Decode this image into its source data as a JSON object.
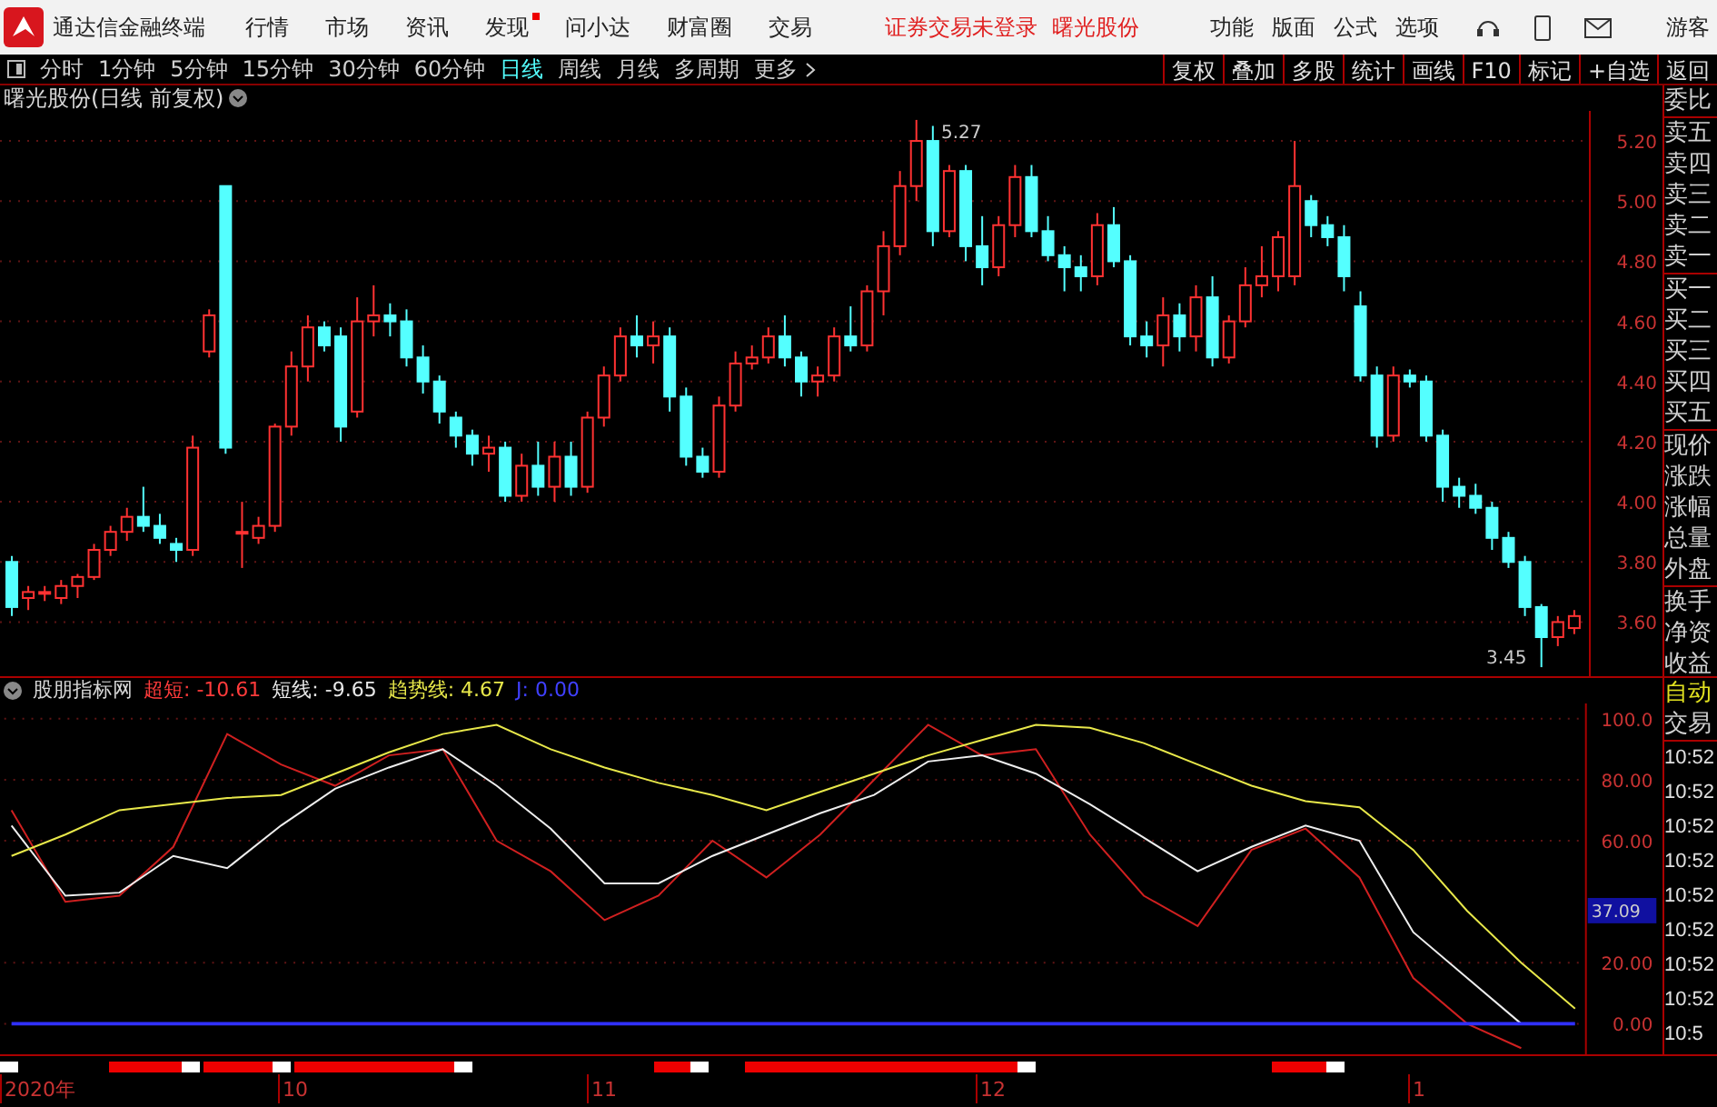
{
  "top_bar": {
    "app_title": "通达信金融终端",
    "menu": [
      {
        "label": "行情",
        "dot": false
      },
      {
        "label": "市场",
        "dot": false
      },
      {
        "label": "资讯",
        "dot": false
      },
      {
        "label": "发现",
        "dot": true
      },
      {
        "label": "问小达",
        "dot": false
      },
      {
        "label": "财富圈",
        "dot": false
      },
      {
        "label": "交易",
        "dot": false
      }
    ],
    "status": "证券交易未登录",
    "stock": "曙光股份",
    "tools": [
      "功能",
      "版面",
      "公式",
      "选项"
    ],
    "user": "游客"
  },
  "toolbar": {
    "periods": [
      {
        "label": "分时",
        "selected": false
      },
      {
        "label": "1分钟",
        "selected": false
      },
      {
        "label": "5分钟",
        "selected": false
      },
      {
        "label": "15分钟",
        "selected": false
      },
      {
        "label": "30分钟",
        "selected": false
      },
      {
        "label": "60分钟",
        "selected": false
      },
      {
        "label": "日线",
        "selected": true
      },
      {
        "label": "周线",
        "selected": false
      },
      {
        "label": "月线",
        "selected": false
      },
      {
        "label": "多周期",
        "selected": false
      },
      {
        "label": "更多",
        "selected": false
      }
    ],
    "actions": [
      "复权",
      "叠加",
      "多股",
      "统计",
      "画线",
      "F10",
      "标记",
      "+自选",
      "返回"
    ]
  },
  "price_chart": {
    "title": "曙光股份(日线 前复权)",
    "high_label": "5.27",
    "low_label": "3.45",
    "chart_data": {
      "type": "candlestick",
      "grid": true,
      "ylim": [
        3.42,
        5.3
      ],
      "yticks": [
        {
          "value": 5.2,
          "label": "5.20"
        },
        {
          "value": 5.0,
          "label": "5.00"
        },
        {
          "value": 4.8,
          "label": "4.80"
        },
        {
          "value": 4.6,
          "label": "4.60"
        },
        {
          "value": 4.4,
          "label": "4.40"
        },
        {
          "value": 4.2,
          "label": "4.20"
        },
        {
          "value": 4.0,
          "label": "4.00"
        },
        {
          "value": 3.8,
          "label": "3.80"
        },
        {
          "value": 3.6,
          "label": "3.60"
        }
      ],
      "ohlc": [
        [
          3.8,
          3.82,
          3.62,
          3.65
        ],
        [
          3.68,
          3.72,
          3.64,
          3.7
        ],
        [
          3.7,
          3.72,
          3.67,
          3.7
        ],
        [
          3.68,
          3.74,
          3.66,
          3.72
        ],
        [
          3.72,
          3.76,
          3.68,
          3.75
        ],
        [
          3.75,
          3.86,
          3.74,
          3.84
        ],
        [
          3.84,
          3.92,
          3.82,
          3.9
        ],
        [
          3.9,
          3.98,
          3.87,
          3.95
        ],
        [
          3.95,
          4.05,
          3.9,
          3.92
        ],
        [
          3.92,
          3.96,
          3.86,
          3.88
        ],
        [
          3.86,
          3.88,
          3.8,
          3.84
        ],
        [
          3.84,
          4.22,
          3.82,
          4.18
        ],
        [
          4.5,
          4.64,
          4.48,
          4.62
        ],
        [
          5.05,
          5.05,
          4.16,
          4.18
        ],
        [
          3.9,
          4.0,
          3.78,
          3.9
        ],
        [
          3.88,
          3.95,
          3.86,
          3.92
        ],
        [
          3.92,
          4.26,
          3.9,
          4.25
        ],
        [
          4.25,
          4.5,
          4.22,
          4.45
        ],
        [
          4.45,
          4.62,
          4.4,
          4.58
        ],
        [
          4.58,
          4.6,
          4.5,
          4.52
        ],
        [
          4.55,
          4.58,
          4.2,
          4.25
        ],
        [
          4.3,
          4.68,
          4.28,
          4.6
        ],
        [
          4.6,
          4.72,
          4.55,
          4.62
        ],
        [
          4.62,
          4.66,
          4.55,
          4.6
        ],
        [
          4.6,
          4.64,
          4.45,
          4.48
        ],
        [
          4.48,
          4.52,
          4.36,
          4.4
        ],
        [
          4.4,
          4.42,
          4.26,
          4.3
        ],
        [
          4.28,
          4.3,
          4.18,
          4.22
        ],
        [
          4.22,
          4.24,
          4.12,
          4.16
        ],
        [
          4.16,
          4.22,
          4.1,
          4.18
        ],
        [
          4.18,
          4.2,
          4.0,
          4.02
        ],
        [
          4.02,
          4.16,
          4.0,
          4.12
        ],
        [
          4.12,
          4.2,
          4.02,
          4.05
        ],
        [
          4.05,
          4.2,
          4.0,
          4.15
        ],
        [
          4.15,
          4.2,
          4.02,
          4.05
        ],
        [
          4.05,
          4.3,
          4.03,
          4.28
        ],
        [
          4.28,
          4.45,
          4.25,
          4.42
        ],
        [
          4.42,
          4.58,
          4.4,
          4.55
        ],
        [
          4.55,
          4.62,
          4.48,
          4.52
        ],
        [
          4.52,
          4.6,
          4.46,
          4.55
        ],
        [
          4.55,
          4.58,
          4.3,
          4.35
        ],
        [
          4.35,
          4.38,
          4.12,
          4.15
        ],
        [
          4.15,
          4.18,
          4.08,
          4.1
        ],
        [
          4.1,
          4.35,
          4.08,
          4.32
        ],
        [
          4.32,
          4.5,
          4.3,
          4.46
        ],
        [
          4.46,
          4.52,
          4.44,
          4.48
        ],
        [
          4.48,
          4.58,
          4.46,
          4.55
        ],
        [
          4.55,
          4.62,
          4.45,
          4.48
        ],
        [
          4.48,
          4.5,
          4.35,
          4.4
        ],
        [
          4.4,
          4.45,
          4.35,
          4.42
        ],
        [
          4.42,
          4.58,
          4.4,
          4.55
        ],
        [
          4.55,
          4.65,
          4.5,
          4.52
        ],
        [
          4.52,
          4.72,
          4.5,
          4.7
        ],
        [
          4.7,
          4.9,
          4.62,
          4.85
        ],
        [
          4.85,
          5.1,
          4.82,
          5.05
        ],
        [
          5.05,
          5.27,
          5.0,
          5.2
        ],
        [
          5.2,
          5.25,
          4.85,
          4.9
        ],
        [
          4.9,
          5.12,
          4.88,
          5.1
        ],
        [
          5.1,
          5.12,
          4.8,
          4.85
        ],
        [
          4.85,
          4.95,
          4.72,
          4.78
        ],
        [
          4.78,
          4.95,
          4.75,
          4.92
        ],
        [
          4.92,
          5.12,
          4.88,
          5.08
        ],
        [
          5.08,
          5.12,
          4.88,
          4.9
        ],
        [
          4.9,
          4.95,
          4.8,
          4.82
        ],
        [
          4.82,
          4.85,
          4.7,
          4.78
        ],
        [
          4.78,
          4.82,
          4.7,
          4.75
        ],
        [
          4.75,
          4.96,
          4.72,
          4.92
        ],
        [
          4.92,
          4.98,
          4.78,
          4.8
        ],
        [
          4.8,
          4.82,
          4.52,
          4.55
        ],
        [
          4.55,
          4.6,
          4.48,
          4.52
        ],
        [
          4.52,
          4.68,
          4.45,
          4.62
        ],
        [
          4.62,
          4.66,
          4.5,
          4.55
        ],
        [
          4.55,
          4.72,
          4.5,
          4.68
        ],
        [
          4.68,
          4.75,
          4.45,
          4.48
        ],
        [
          4.48,
          4.62,
          4.46,
          4.6
        ],
        [
          4.6,
          4.78,
          4.58,
          4.72
        ],
        [
          4.72,
          4.85,
          4.68,
          4.75
        ],
        [
          4.75,
          4.9,
          4.7,
          4.88
        ],
        [
          4.75,
          5.2,
          4.72,
          5.05
        ],
        [
          5.0,
          5.02,
          4.88,
          4.92
        ],
        [
          4.92,
          4.95,
          4.85,
          4.88
        ],
        [
          4.88,
          4.92,
          4.7,
          4.75
        ],
        [
          4.65,
          4.7,
          4.4,
          4.42
        ],
        [
          4.42,
          4.45,
          4.18,
          4.22
        ],
        [
          4.22,
          4.45,
          4.2,
          4.42
        ],
        [
          4.42,
          4.44,
          4.38,
          4.4
        ],
        [
          4.4,
          4.42,
          4.2,
          4.22
        ],
        [
          4.22,
          4.24,
          4.0,
          4.05
        ],
        [
          4.05,
          4.08,
          3.98,
          4.02
        ],
        [
          4.02,
          4.06,
          3.96,
          3.98
        ],
        [
          3.98,
          4.0,
          3.84,
          3.88
        ],
        [
          3.88,
          3.9,
          3.78,
          3.8
        ],
        [
          3.8,
          3.82,
          3.62,
          3.65
        ],
        [
          3.65,
          3.66,
          3.45,
          3.55
        ],
        [
          3.55,
          3.62,
          3.52,
          3.6
        ],
        [
          3.58,
          3.64,
          3.56,
          3.62
        ]
      ]
    }
  },
  "quote_panel": {
    "groups": [
      {
        "items": [
          "委比"
        ]
      },
      {
        "items": [
          "卖五",
          "卖四",
          "卖三",
          "卖二",
          "卖一"
        ]
      },
      {
        "items": [
          "买一",
          "买二",
          "买三",
          "买四",
          "买五"
        ]
      },
      {
        "items": [
          "现价",
          "涨跌",
          "涨幅",
          "总量",
          "外盘"
        ]
      },
      {
        "items": [
          "换手",
          "净资",
          "收益"
        ]
      }
    ]
  },
  "indicator": {
    "name": "股朋指标网",
    "legend": [
      {
        "text": "超短: -10.61",
        "color": "#ff3b3b"
      },
      {
        "text": "短线: -9.65",
        "color": "#e8e8e8"
      },
      {
        "text": "趋势线: 4.67",
        "color": "#e8e84a"
      },
      {
        "text": "J: 0.00",
        "color": "#4040ff"
      }
    ],
    "current_value": "37.09",
    "chart_data": {
      "type": "line",
      "grid": true,
      "ylim": [
        -10,
        105
      ],
      "yticks": [
        {
          "value": 100,
          "label": "100.0"
        },
        {
          "value": 80,
          "label": "80.00"
        },
        {
          "value": 60,
          "label": "60.00"
        },
        {
          "value": 20,
          "label": "20.00"
        },
        {
          "value": 0,
          "label": "0.00"
        }
      ],
      "series": [
        {
          "color": "#d02020",
          "values": [
            70,
            40,
            42,
            58,
            95,
            85,
            78,
            88,
            90,
            60,
            50,
            34,
            42,
            60,
            48,
            62,
            80,
            98,
            88,
            90,
            62,
            42,
            32,
            57,
            64,
            48,
            15,
            0,
            -8,
            null
          ]
        },
        {
          "color": "#eeeeee",
          "values": [
            65,
            42,
            43,
            55,
            51,
            65,
            77,
            84,
            90,
            78,
            64,
            46,
            46,
            55,
            62,
            69,
            75,
            86,
            88,
            82,
            72,
            61,
            50,
            58,
            65,
            60,
            30,
            15,
            0,
            null
          ]
        },
        {
          "color": "#e8e84a",
          "values": [
            55,
            62,
            70,
            72,
            74,
            75,
            82,
            89,
            95,
            98,
            90,
            84,
            79,
            75,
            70,
            76,
            82,
            88,
            93,
            98,
            97,
            92,
            85,
            78,
            73,
            71,
            57,
            37,
            20,
            5
          ]
        },
        {
          "color": "#3030ff",
          "values": [
            0,
            0,
            0,
            0,
            0,
            0,
            0,
            0,
            0,
            0,
            0,
            0,
            0,
            0,
            0,
            0,
            0,
            0,
            0,
            0,
            0,
            0,
            0,
            0,
            0,
            0,
            0,
            0,
            0,
            0
          ]
        }
      ]
    }
  },
  "side_list": {
    "mode": "自动",
    "header": "交易",
    "times": [
      "10:52",
      "10:52",
      "10:52",
      "10:52",
      "10:52",
      "10:52",
      "10:52",
      "10:52",
      "10:5"
    ]
  },
  "x_axis": [
    "2020年",
    "10",
    "11",
    "12",
    "1"
  ]
}
